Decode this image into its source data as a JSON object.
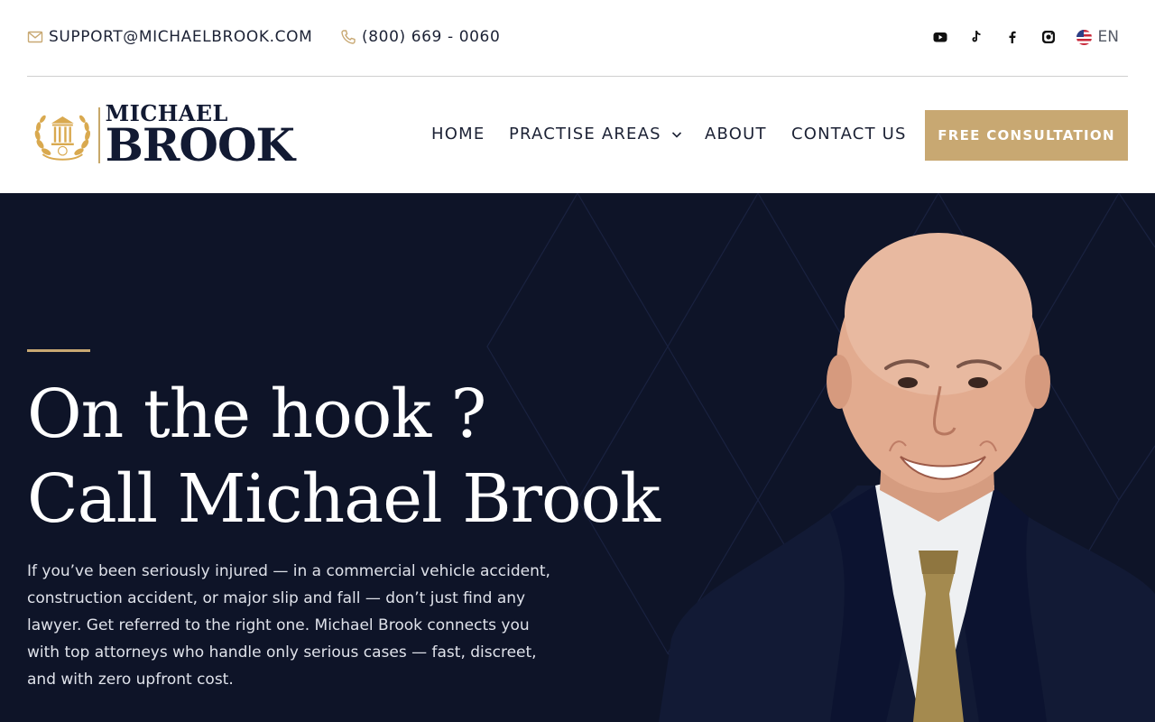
{
  "topbar": {
    "email": "SUPPORT@MICHAELBROOK.COM",
    "phone": "(800) 669 - 0060",
    "social": [
      "youtube-icon",
      "tiktok-icon",
      "facebook-icon",
      "instagram-icon"
    ],
    "language": "EN"
  },
  "header": {
    "logo": {
      "line1": "MICHAEL",
      "line2": "BROOK"
    },
    "nav": {
      "home": "HOME",
      "practise_areas": "PRACTISE AREAS",
      "about": "ABOUT",
      "contact_us": "CONTACT US"
    },
    "cta": "FREE CONSULTATION"
  },
  "hero": {
    "headline_line1": "On the hook ?",
    "headline_line2": "Call Michael Brook",
    "intro": "If you’ve been seriously injured — in a commercial vehicle accident, construction accident, or major slip and fall — don’t just find any lawyer. Get referred to the right one. Michael Brook connects you with top attorneys who handle only serious cases — fast, discreet, and with zero upfront cost."
  },
  "colors": {
    "accent_gold": "#c8a872",
    "hero_navy": "#0e1428",
    "text_dark": "#1c2235"
  }
}
